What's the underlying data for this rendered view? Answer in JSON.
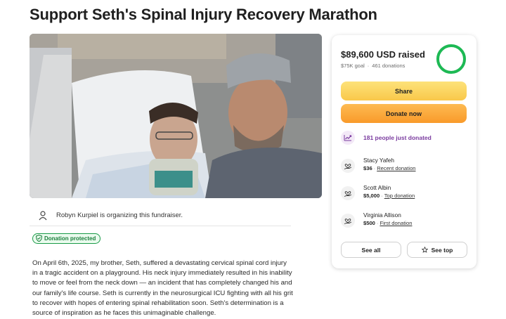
{
  "campaign": {
    "title": "Support Seth's Spinal Injury Recovery Marathon",
    "organizer_text": "Robyn Kurpiel is organizing this fundraiser.",
    "protected_label": "Donation protected",
    "story": "On April 6th, 2025, my brother, Seth, suffered a devastating cervical spinal cord injury in a tragic accident on a playground. His neck injury immediately resulted in his inability to move or feel from the neck down — an incident that has completely changed his and our family's life course. Seth is currently in the neurosurgical ICU fighting with all his grit to recover with hopes of entering spinal rehabilitation soon. Seth's determination is a source of inspiration as he faces this unimaginable challenge."
  },
  "summary": {
    "raised": "$89,600 USD raised",
    "goal": "$75K goal",
    "donations": "461 donations",
    "progress_fraction": 1.0,
    "share_label": "Share",
    "donate_label": "Donate now",
    "just_donated": "181 people just donated"
  },
  "donations": [
    {
      "name": "Stacy Yafeh",
      "amount": "$36",
      "tag": "Recent donation"
    },
    {
      "name": "Scott Albin",
      "amount": "$5,000",
      "tag": "Top donation"
    },
    {
      "name": "Virginia Allison",
      "amount": "$500",
      "tag": "First donation"
    }
  ],
  "actions": {
    "see_all": "See all",
    "see_top": "See top"
  },
  "colors": {
    "progress": "#1db954",
    "share": "#f9c84a",
    "donate": "#f99a2a",
    "accent_purple": "#7a3b9f",
    "protected_green": "#1a9b48"
  },
  "icons": {
    "organizer": "person-icon",
    "protected": "shield-check-icon",
    "trend": "trending-up-icon",
    "donor": "hand-heart-icon",
    "see_top": "star-icon"
  }
}
